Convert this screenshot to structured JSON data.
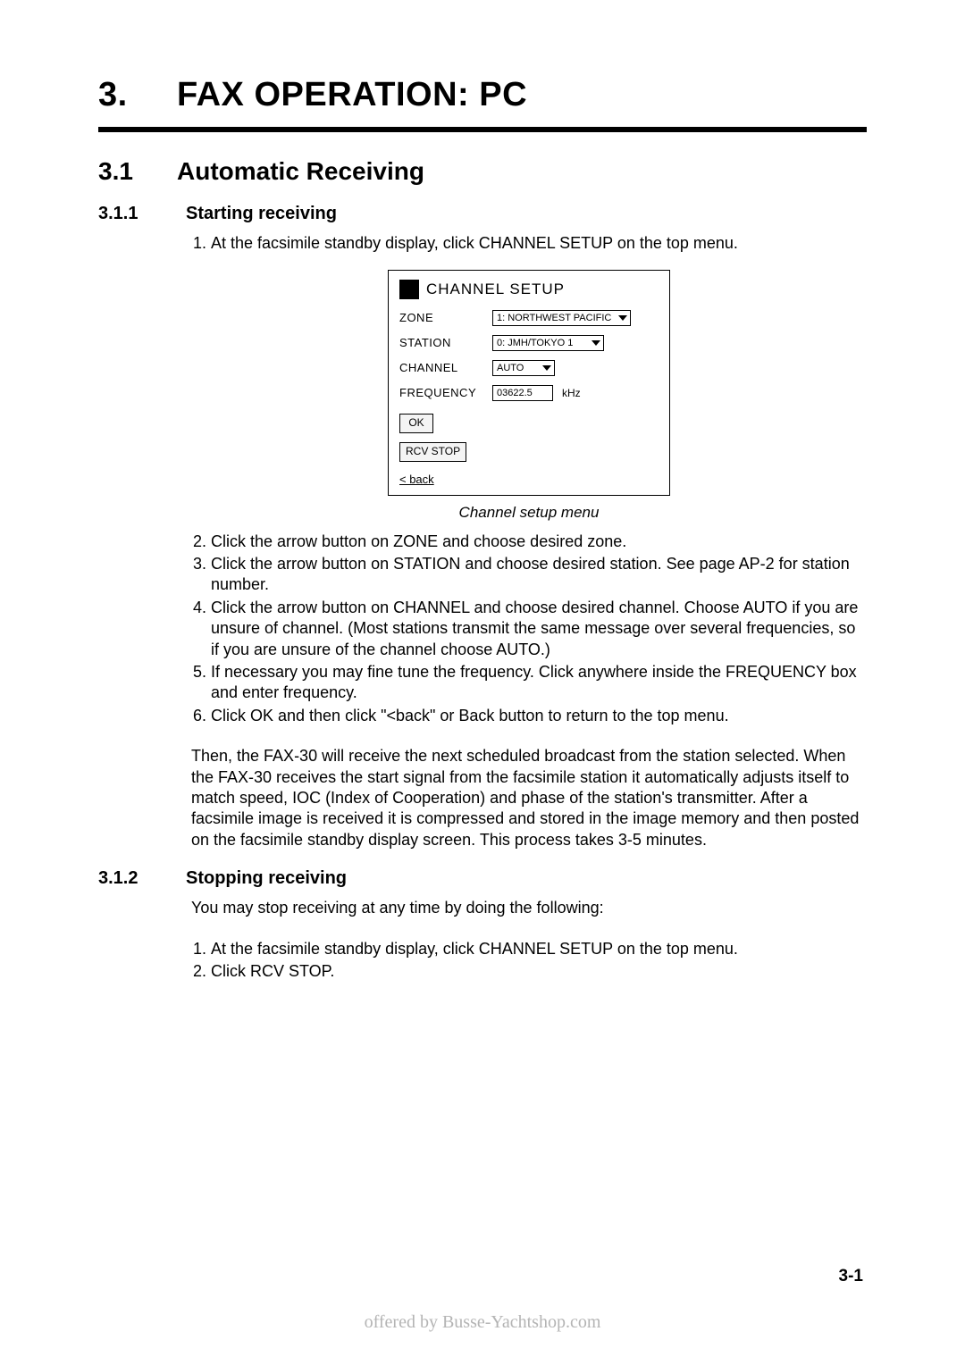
{
  "chapter": {
    "number": "3.",
    "title": "FAX OPERATION: PC"
  },
  "section": {
    "number": "3.1",
    "title": "Automatic Receiving"
  },
  "subsection1": {
    "number": "3.1.1",
    "title": "Starting receiving"
  },
  "steps1": [
    "At the facsimile standby display, click CHANNEL SETUP on the top menu.",
    "Click the arrow button on ZONE and choose desired zone.",
    "Click the arrow button on STATION and choose desired station. See page AP-2 for station number.",
    "Click the arrow button on CHANNEL and choose desired channel. Choose AUTO if you are unsure of channel. (Most stations transmit the same message over several frequencies, so if you are unsure of the channel choose AUTO.)",
    "If necessary you may fine tune the frequency. Click anywhere inside the FREQUENCY box and enter frequency.",
    "Click OK and then click \"<back\" or Back button to return to the top menu."
  ],
  "channel_setup": {
    "title": "CHANNEL SETUP",
    "zone_label": "ZONE",
    "zone_value": "1: NORTHWEST PACIFIC",
    "station_label": "STATION",
    "station_value": "0: JMH/TOKYO 1",
    "channel_label": "CHANNEL",
    "channel_value": "AUTO",
    "frequency_label": "FREQUENCY",
    "frequency_value": "03622.5",
    "frequency_unit": "kHz",
    "ok_label": "OK",
    "rcvstop_label": "RCV STOP",
    "back_label": "< back"
  },
  "figure_caption": "Channel setup menu",
  "paragraph": "Then, the FAX-30 will receive the next scheduled broadcast from the station selected. When the FAX-30 receives the start signal from the facsimile station it automatically adjusts itself to match speed, IOC (Index of Cooperation) and phase of the station's transmitter. After a facsimile image is received it is compressed and stored in the image memory and then posted on the facsimile standby display screen. This process takes 3-5 minutes.",
  "subsection2": {
    "number": "3.1.2",
    "title": "Stopping receiving"
  },
  "stop_intro": "You may stop receiving at any time by doing the following:",
  "steps2": [
    "At the facsimile standby display, click CHANNEL SETUP on the top menu.",
    "Click RCV STOP."
  ],
  "page_number": "3-1",
  "footer": "offered by Busse-Yachtshop.com"
}
